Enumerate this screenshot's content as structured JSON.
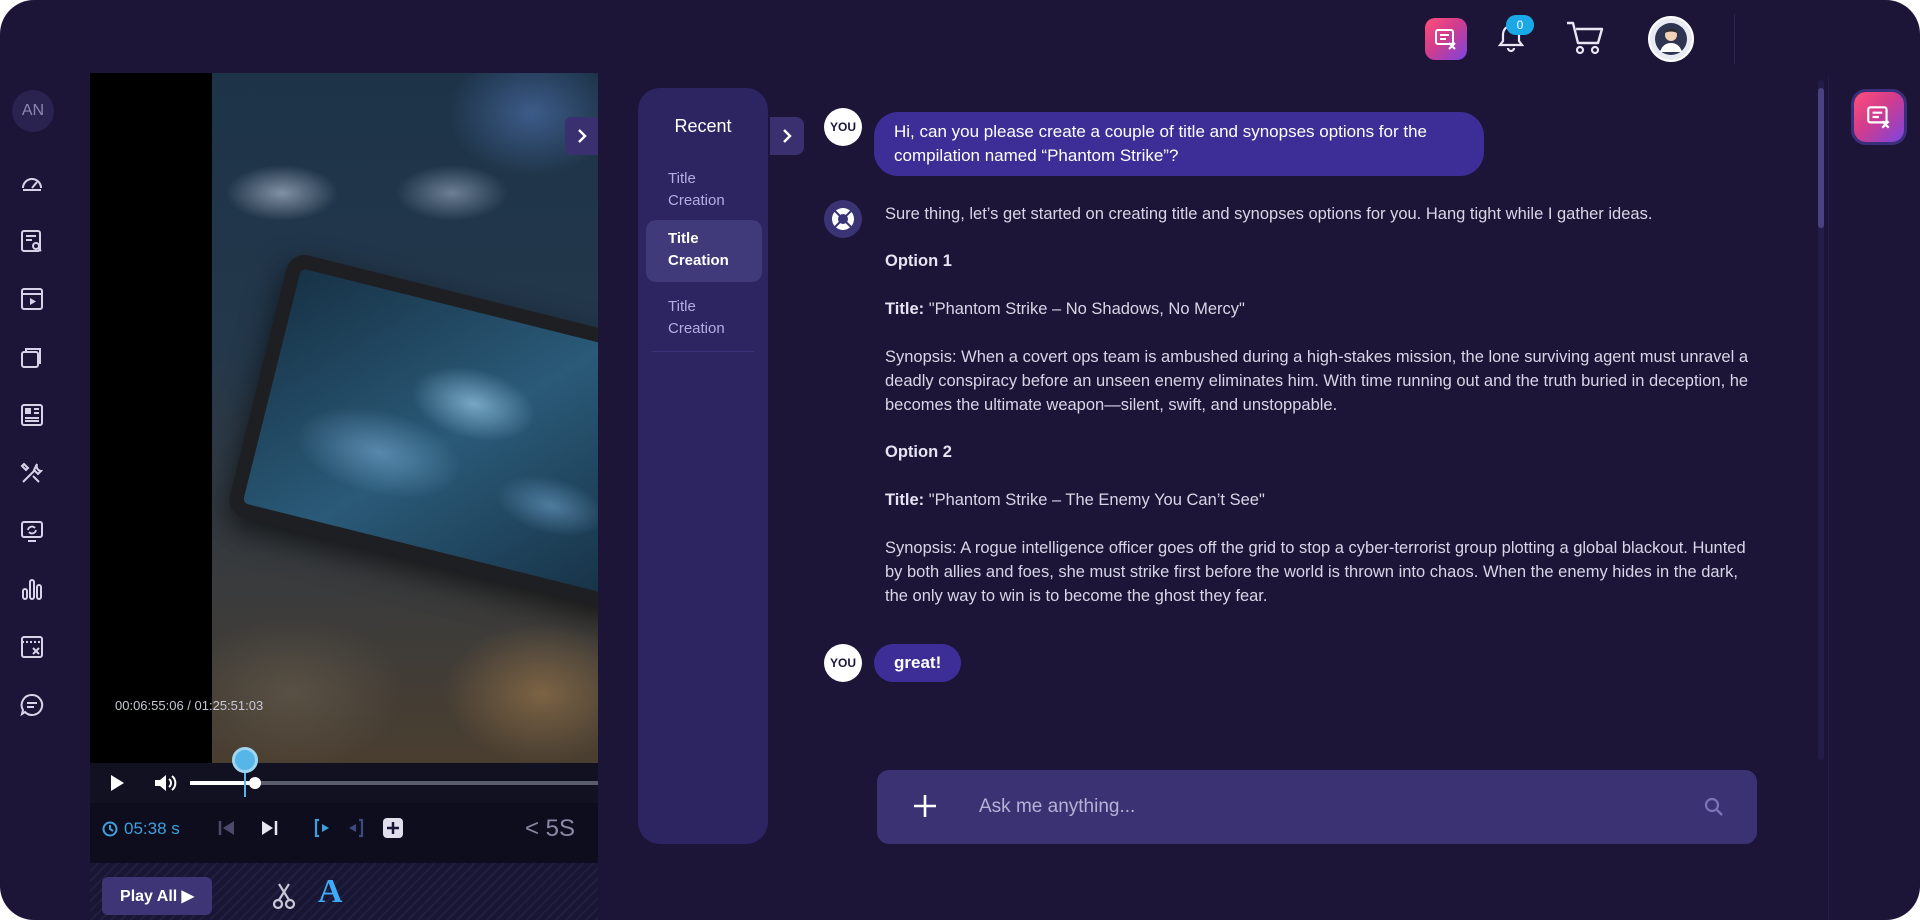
{
  "topbar": {
    "notification_count": "0",
    "icons": [
      "brand-chat-icon",
      "bell-icon",
      "cart-icon",
      "user-avatar"
    ]
  },
  "nav": {
    "avatar_initials": "AN",
    "items": [
      "dashboard-icon",
      "search-list-icon",
      "video-library-icon",
      "folders-icon",
      "layout-icon",
      "tools-icon",
      "refresh-screen-icon",
      "analytics-icon",
      "clip-edit-icon",
      "chat-icon"
    ]
  },
  "video": {
    "timecode": "00:06:55:06 / 01:25:51:03",
    "progress_percent": 16,
    "duration_label": "05:38 s",
    "step_label": "< 5S",
    "play_all_label": "Play All ▶",
    "text_tool_label": "A"
  },
  "recent": {
    "title": "Recent",
    "items": [
      {
        "label": "Title Creation",
        "active": false
      },
      {
        "label": "Title Creation",
        "active": true
      },
      {
        "label": "Title Creation",
        "active": false
      }
    ]
  },
  "chat": {
    "user_label": "YOU",
    "user_message_1": "Hi, can you please create a couple of title and synopses options for the compilation named “Phantom Strike”?",
    "bot_intro": "Sure thing, let’s get started on creating title and synopses options for you. Hang tight while I gather ideas.",
    "option1_heading": "Option 1",
    "option1_title_label": "Title:",
    "option1_title": " \"Phantom Strike – No Shadows, No Mercy\"",
    "option1_synopsis": "Synopsis: When a covert ops team is ambushed during a high-stakes mission, the lone surviving agent must unravel a deadly conspiracy before an unseen enemy eliminates him. With time running out and the truth buried in deception, he becomes the ultimate weapon—silent, swift, and unstoppable.",
    "option2_heading": "Option 2",
    "option2_title_label": "Title:",
    "option2_title": " \"Phantom Strike – The Enemy You Can’t See\"",
    "option2_synopsis": "Synopsis: A rogue intelligence officer goes off the grid to stop a cyber-terrorist group plotting a global blackout. Hunted by both allies and foes, she must strike first before the world is thrown into chaos. When the enemy hides in the dark, the only way to win is to become the ghost they fear.",
    "user_message_2": "great!"
  },
  "input": {
    "placeholder": "Ask me anything..."
  }
}
